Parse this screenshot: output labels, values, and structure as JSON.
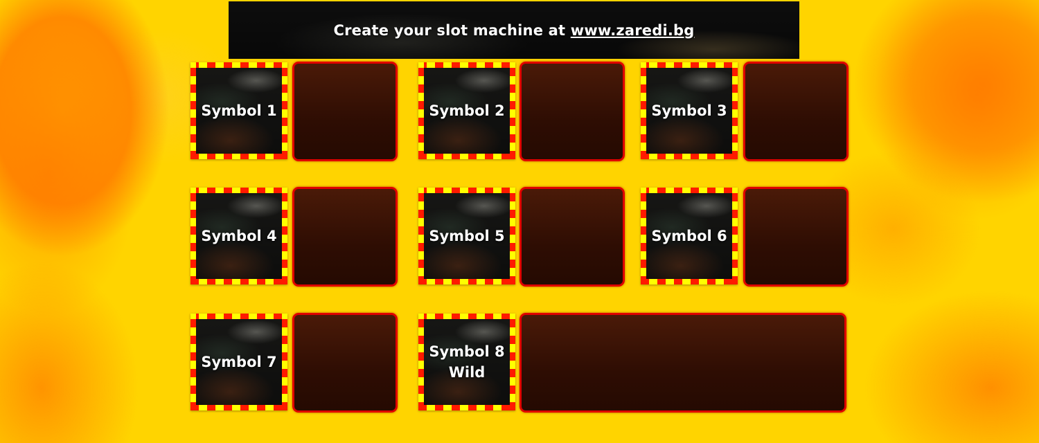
{
  "banner": {
    "prefix": "Create your slot machine at ",
    "link_text": "www.zaredi.bg"
  },
  "symbols": [
    {
      "label": "Symbol 1"
    },
    {
      "label": "Symbol 2"
    },
    {
      "label": "Symbol 3"
    },
    {
      "label": "Symbol 4"
    },
    {
      "label": "Symbol 5"
    },
    {
      "label": "Symbol 6"
    },
    {
      "label": "Symbol 7"
    },
    {
      "label": "Symbol 8\nWild"
    }
  ],
  "colors": {
    "background": "#ffd400",
    "stripe_red": "#ff1a00",
    "stripe_yellow": "#ffff00",
    "result_box": "#2e0d03",
    "result_border": "#e00000"
  }
}
